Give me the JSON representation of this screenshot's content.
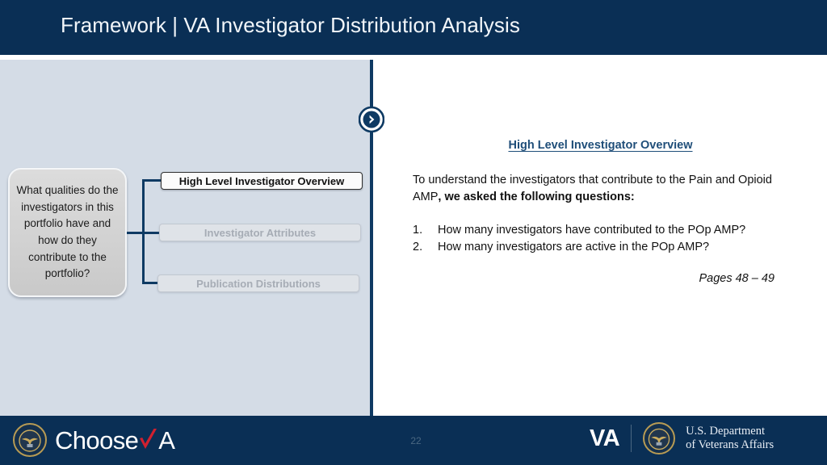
{
  "header": {
    "title": "Framework | VA Investigator Distribution Analysis",
    "background": "#0a2f55"
  },
  "divider": {
    "icon": "chevron-right-circle-icon",
    "color": "#0e3a63"
  },
  "left_panel": {
    "background": "#d4dce6",
    "question_box": {
      "text": "What qualities do the investigators in this portfolio have and how do they contribute to the portfolio?"
    },
    "nodes": [
      {
        "label": "High Level Investigator Overview",
        "state": "active"
      },
      {
        "label": "Investigator Attributes",
        "state": "muted"
      },
      {
        "label": "Publication Distributions",
        "state": "muted"
      }
    ]
  },
  "right_panel": {
    "heading": "High Level Investigator Overview",
    "paragraph_plain": "To understand the investigators that contribute to the Pain and Opioid AMP",
    "paragraph_bold": ", we asked the following questions:",
    "questions": [
      {
        "number": "1.",
        "text": "How many investigators have contributed to the POp AMP?"
      },
      {
        "number": "2.",
        "text": "How many investigators are active in the POp AMP?"
      }
    ],
    "pages_note": "Pages 48 – 49",
    "heading_color": "#1f4e79"
  },
  "footer": {
    "choose_va": {
      "seal": "va-seal-icon",
      "word_first": "Choose",
      "check": "red-check-v",
      "word_last": "A",
      "check_color": "#d0202f"
    },
    "page_number": "22",
    "va_mark": "VA",
    "seal": "va-seal-icon",
    "department_line1": "U.S. Department",
    "department_line2": "of Veterans Affairs",
    "background": "#0a2f55"
  }
}
